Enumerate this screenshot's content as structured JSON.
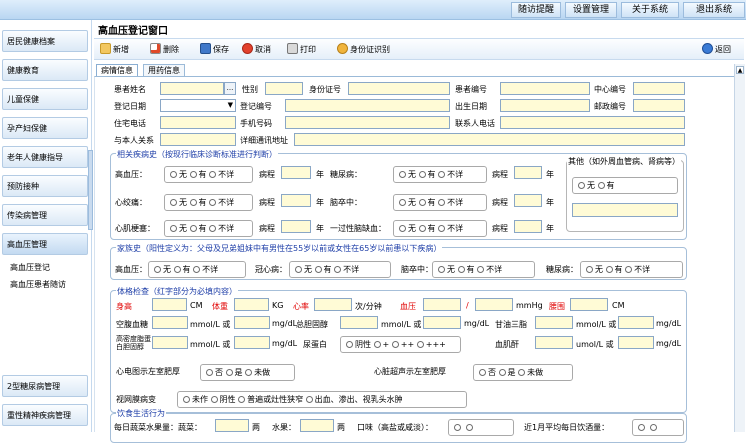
{
  "topnav": {
    "items": [
      "随访提醒",
      "设置管理",
      "关于系统",
      "退出系统"
    ]
  },
  "sidebar": {
    "items": [
      "居民健康档案",
      "健康教育",
      "儿童保健",
      "孕产妇保健",
      "老年人健康指导",
      "预防接种",
      "传染病管理",
      "高血压管理"
    ],
    "subitems": [
      "高血压登记",
      "高血压患者随访"
    ],
    "bottom_items": [
      "2型糖尿病管理",
      "重性精神疾病管理"
    ]
  },
  "window": {
    "title": "高血压登记窗口"
  },
  "toolbar": {
    "add": "新增",
    "delete": "删除",
    "save": "保存",
    "cancel": "取消",
    "print": "打印",
    "id_read": "身份证识别",
    "back": "返回"
  },
  "tabs": [
    "病情信息",
    "用药信息"
  ],
  "basic": {
    "name": "患者姓名",
    "browse_btn": "...",
    "gender": "性别",
    "id_no": "身份证号",
    "patient_no": "患者编号",
    "center_no": "中心编号",
    "reg_date": "登记日期",
    "reg_no": "登记编号",
    "birth": "出生日期",
    "zip": "邮政编号",
    "home_tel": "住宅电话",
    "mobile": "手机号码",
    "contact_tel": "联系人电话",
    "relation": "与本人关系",
    "address": "详细通讯地址"
  },
  "history": {
    "title": "相关疾病史（按现行临床诊断标准进行判断）",
    "rows": [
      {
        "left": "高血压：",
        "mid": "糖尿病："
      },
      {
        "left": "心绞痛：",
        "mid": "脑卒中："
      },
      {
        "left": "心肌梗塞：",
        "mid": "一过性脑缺血："
      }
    ],
    "course": "病程",
    "year": "年",
    "other_title": "其他（如外周血管病、肾病等）"
  },
  "opts": {
    "none": "无",
    "yes": "有",
    "unknown": "不详",
    "no": "否",
    "is": "是",
    "undone": "未做",
    "notdone": "未作",
    "negative": "阴性"
  },
  "family": {
    "title": "家族史（阳性定义为：父母及兄弟姐妹中有男性在55岁以前或女性在65岁以前患以下疾病）",
    "items": [
      "高血压：",
      "冠心病：",
      "脑卒中：",
      "糖尿病："
    ]
  },
  "exam": {
    "title": "体格检查（红字部分为必填内容）",
    "height": "身高",
    "cm": "CM",
    "weight": "体重",
    "kg": "KG",
    "hr": "心率",
    "per_min": "次/分钟",
    "bp": "血压",
    "slash": "/",
    "mmhg": "mmHg",
    "waist": "腰围",
    "fbg": "空腹血糖",
    "mmol": "mmol/L 或",
    "mgdl": "mg/dL",
    "tc": "总胆固醇",
    "tg": "甘油三脂",
    "hdl_label": "高密度脂蛋白胆固醇",
    "umol": "umol/L 或",
    "protein": "尿蛋白",
    "protein_opts": [
      "阴性",
      "+",
      "++",
      "+++"
    ],
    "creat": "血肌酐",
    "ecg": "心电图示左室肥厚",
    "echo": "心脏超声示左室肥厚",
    "retina": "视网膜病变",
    "retina_opts": [
      "未作",
      "阴性",
      "普遍或灶性狭窄",
      "出血、渗出、视乳头水肿"
    ]
  },
  "diet": {
    "title": "饮食生活行为",
    "row1": "每日蔬菜水果量：蔬菜：",
    "liang1": "两",
    "fruit": "水果：",
    "liang2": "两",
    "taste": "口味（高盐或咸淡）：",
    "drink": "近1月平均每日饮酒量："
  }
}
